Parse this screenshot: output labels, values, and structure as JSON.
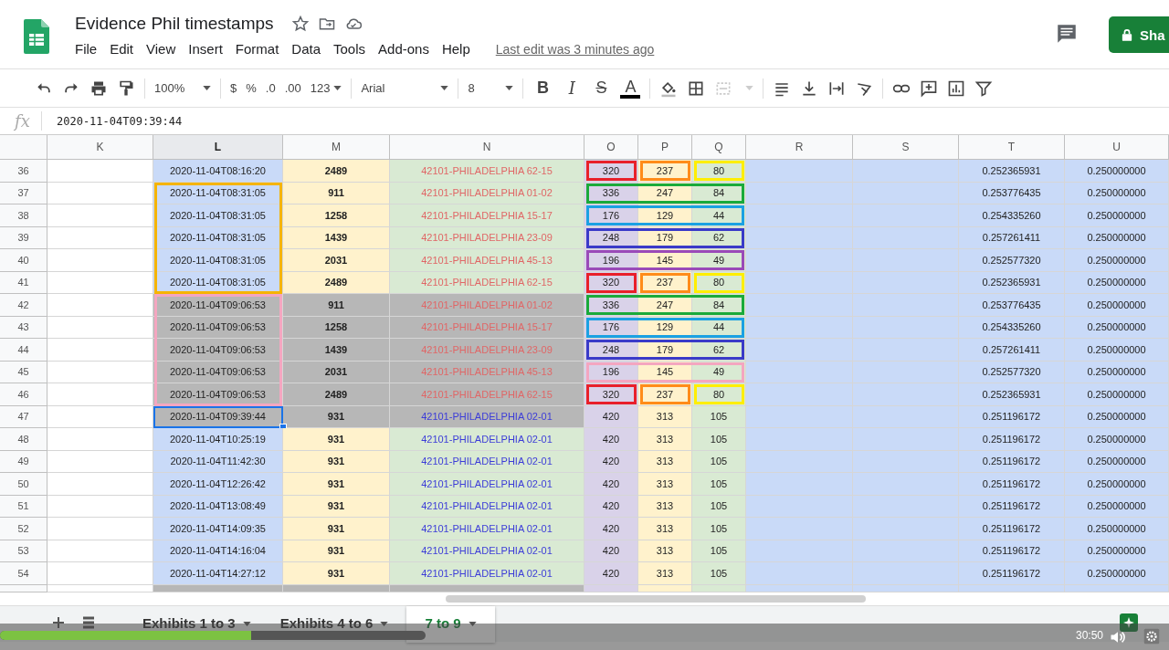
{
  "title": "Evidence Phil timestamps",
  "menu": [
    "File",
    "Edit",
    "View",
    "Insert",
    "Format",
    "Data",
    "Tools",
    "Add-ons",
    "Help"
  ],
  "last_edit": "Last edit was 3 minutes ago",
  "share": {
    "label": "Sha"
  },
  "toolbar": {
    "zoom": "100%",
    "currency": "$",
    "percent": "%",
    "dec_less": ".0",
    "dec_more": ".00",
    "number_format": "123",
    "font": "Arial",
    "font_size": "8",
    "bold": "B",
    "italic": "I",
    "strike": "S",
    "text_color": "A"
  },
  "formula_bar": {
    "label": "fx",
    "value": "2020-11-04T09:39:44"
  },
  "columns": [
    "K",
    "L",
    "M",
    "N",
    "O",
    "P",
    "Q",
    "R",
    "S",
    "T",
    "U"
  ],
  "rows": [
    {
      "num": "36",
      "time": "2020-11-04T08:16:20",
      "count": "2489",
      "name": "42101-PHILADELPHIA 62-15",
      "color": "#e06666",
      "o": "320",
      "p": "237",
      "q": "80",
      "t": "0.252365931",
      "u": "0.250000000",
      "shaded": false,
      "selected": false,
      "outlines": [
        {
          "kind": "o",
          "color": "#e8202a"
        },
        {
          "kind": "p",
          "color": "#ff8c1a"
        },
        {
          "kind": "q",
          "color": "#ffee00"
        }
      ]
    },
    {
      "num": "37",
      "time": "2020-11-04T08:31:05",
      "count": "911",
      "name": "42101-PHILADELPHIA 01-02",
      "color": "#e06666",
      "o": "336",
      "p": "247",
      "q": "84",
      "t": "0.253776435",
      "u": "0.250000000",
      "shaded": false,
      "selected": false,
      "group": {
        "color": "#f5b400"
      },
      "outlines": [
        {
          "kind": "opq",
          "color": "#1aaa3a"
        }
      ]
    },
    {
      "num": "38",
      "time": "2020-11-04T08:31:05",
      "count": "1258",
      "name": "42101-PHILADELPHIA 15-17",
      "color": "#e06666",
      "o": "176",
      "p": "129",
      "q": "44",
      "t": "0.254335260",
      "u": "0.250000000",
      "shaded": false,
      "selected": false,
      "group": {
        "color": "#f5b400"
      },
      "outlines": [
        {
          "kind": "opq",
          "color": "#1ba1e2"
        }
      ]
    },
    {
      "num": "39",
      "time": "2020-11-04T08:31:05",
      "count": "1439",
      "name": "42101-PHILADELPHIA 23-09",
      "color": "#e06666",
      "o": "248",
      "p": "179",
      "q": "62",
      "t": "0.257261411",
      "u": "0.250000000",
      "shaded": false,
      "selected": false,
      "group": {
        "color": "#f5b400"
      },
      "outlines": [
        {
          "kind": "opq",
          "color": "#3a3ac8"
        }
      ]
    },
    {
      "num": "40",
      "time": "2020-11-04T08:31:05",
      "count": "2031",
      "name": "42101-PHILADELPHIA 45-13",
      "color": "#e06666",
      "o": "196",
      "p": "145",
      "q": "49",
      "t": "0.252577320",
      "u": "0.250000000",
      "shaded": false,
      "selected": false,
      "group": {
        "color": "#f5b400"
      },
      "outlines": [
        {
          "kind": "opq",
          "color": "#9a4ab8"
        }
      ]
    },
    {
      "num": "41",
      "time": "2020-11-04T08:31:05",
      "count": "2489",
      "name": "42101-PHILADELPHIA 62-15",
      "color": "#e06666",
      "o": "320",
      "p": "237",
      "q": "80",
      "t": "0.252365931",
      "u": "0.250000000",
      "shaded": false,
      "selected": false,
      "group": {
        "color": "#f5b400"
      },
      "outlines": [
        {
          "kind": "o",
          "color": "#e8202a"
        },
        {
          "kind": "p",
          "color": "#ff8c1a"
        },
        {
          "kind": "q",
          "color": "#ffee00"
        }
      ]
    },
    {
      "num": "42",
      "time": "2020-11-04T09:06:53",
      "count": "911",
      "name": "42101-PHILADELPHIA 01-02",
      "color": "#e06666",
      "o": "336",
      "p": "247",
      "q": "84",
      "t": "0.253776435",
      "u": "0.250000000",
      "shaded": true,
      "selected": false,
      "group": {
        "color": "#f4a6c0"
      },
      "outlines": [
        {
          "kind": "opq",
          "color": "#1aaa3a"
        }
      ]
    },
    {
      "num": "43",
      "time": "2020-11-04T09:06:53",
      "count": "1258",
      "name": "42101-PHILADELPHIA 15-17",
      "color": "#e06666",
      "o": "176",
      "p": "129",
      "q": "44",
      "t": "0.254335260",
      "u": "0.250000000",
      "shaded": true,
      "selected": false,
      "group": {
        "color": "#f4a6c0"
      },
      "outlines": [
        {
          "kind": "opq",
          "color": "#1ba1e2"
        }
      ]
    },
    {
      "num": "44",
      "time": "2020-11-04T09:06:53",
      "count": "1439",
      "name": "42101-PHILADELPHIA 23-09",
      "color": "#e06666",
      "o": "248",
      "p": "179",
      "q": "62",
      "t": "0.257261411",
      "u": "0.250000000",
      "shaded": true,
      "selected": false,
      "group": {
        "color": "#f4a6c0"
      },
      "outlines": [
        {
          "kind": "opq",
          "color": "#3a3ac8"
        }
      ]
    },
    {
      "num": "45",
      "time": "2020-11-04T09:06:53",
      "count": "2031",
      "name": "42101-PHILADELPHIA 45-13",
      "color": "#e06666",
      "o": "196",
      "p": "145",
      "q": "49",
      "t": "0.252577320",
      "u": "0.250000000",
      "shaded": true,
      "selected": false,
      "group": {
        "color": "#f4a6c0"
      },
      "outlines": [
        {
          "kind": "opq",
          "color": "#f4a6c0"
        }
      ]
    },
    {
      "num": "46",
      "time": "2020-11-04T09:06:53",
      "count": "2489",
      "name": "42101-PHILADELPHIA 62-15",
      "color": "#e06666",
      "o": "320",
      "p": "237",
      "q": "80",
      "t": "0.252365931",
      "u": "0.250000000",
      "shaded": true,
      "selected": false,
      "group": {
        "color": "#f4a6c0"
      },
      "outlines": [
        {
          "kind": "o",
          "color": "#e8202a"
        },
        {
          "kind": "p",
          "color": "#ff8c1a"
        },
        {
          "kind": "q",
          "color": "#ffee00"
        }
      ]
    },
    {
      "num": "47",
      "time": "2020-11-04T09:39:44",
      "count": "931",
      "name": "42101-PHILADELPHIA 02-01",
      "color": "#3c3cd8",
      "o": "420",
      "p": "313",
      "q": "105",
      "t": "0.251196172",
      "u": "0.250000000",
      "shaded": true,
      "selected": true
    },
    {
      "num": "48",
      "time": "2020-11-04T10:25:19",
      "count": "931",
      "name": "42101-PHILADELPHIA 02-01",
      "color": "#3c3cd8",
      "o": "420",
      "p": "313",
      "q": "105",
      "t": "0.251196172",
      "u": "0.250000000",
      "shaded": false,
      "selected": false
    },
    {
      "num": "49",
      "time": "2020-11-04T11:42:30",
      "count": "931",
      "name": "42101-PHILADELPHIA 02-01",
      "color": "#3c3cd8",
      "o": "420",
      "p": "313",
      "q": "105",
      "t": "0.251196172",
      "u": "0.250000000",
      "shaded": false,
      "selected": false
    },
    {
      "num": "50",
      "time": "2020-11-04T12:26:42",
      "count": "931",
      "name": "42101-PHILADELPHIA 02-01",
      "color": "#3c3cd8",
      "o": "420",
      "p": "313",
      "q": "105",
      "t": "0.251196172",
      "u": "0.250000000",
      "shaded": false,
      "selected": false
    },
    {
      "num": "51",
      "time": "2020-11-04T13:08:49",
      "count": "931",
      "name": "42101-PHILADELPHIA 02-01",
      "color": "#3c3cd8",
      "o": "420",
      "p": "313",
      "q": "105",
      "t": "0.251196172",
      "u": "0.250000000",
      "shaded": false,
      "selected": false
    },
    {
      "num": "52",
      "time": "2020-11-04T14:09:35",
      "count": "931",
      "name": "42101-PHILADELPHIA 02-01",
      "color": "#3c3cd8",
      "o": "420",
      "p": "313",
      "q": "105",
      "t": "0.251196172",
      "u": "0.250000000",
      "shaded": false,
      "selected": false
    },
    {
      "num": "53",
      "time": "2020-11-04T14:16:04",
      "count": "931",
      "name": "42101-PHILADELPHIA 02-01",
      "color": "#3c3cd8",
      "o": "420",
      "p": "313",
      "q": "105",
      "t": "0.251196172",
      "u": "0.250000000",
      "shaded": false,
      "selected": false
    },
    {
      "num": "54",
      "time": "2020-11-04T14:27:12",
      "count": "931",
      "name": "42101-PHILADELPHIA 02-01",
      "color": "#3c3cd8",
      "o": "420",
      "p": "313",
      "q": "105",
      "t": "0.251196172",
      "u": "0.250000000",
      "shaded": false,
      "selected": false
    }
  ],
  "sheet_tabs": [
    {
      "label": "Exhibits 1 to 3",
      "selected": false
    },
    {
      "label": "Exhibits 4 to 6",
      "selected": false
    },
    {
      "label": "7 to 9",
      "selected": true
    }
  ],
  "video": {
    "progress": {
      "level": 0.59
    },
    "time": "30:50"
  }
}
